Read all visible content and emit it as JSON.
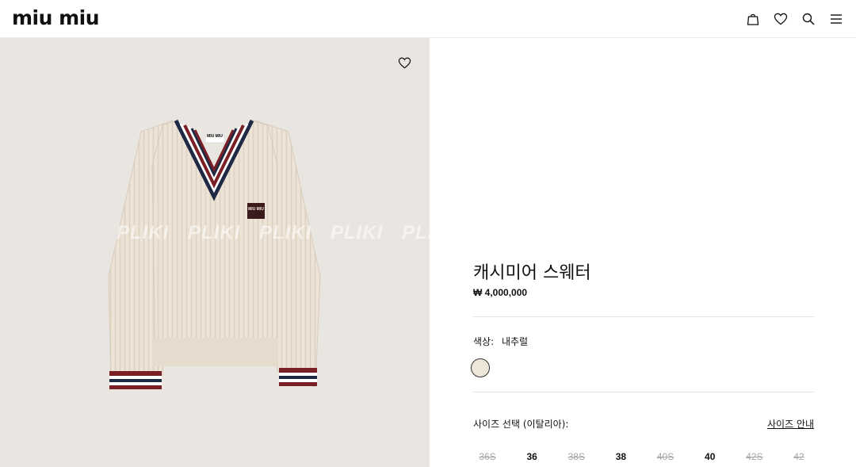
{
  "header": {
    "logo": "miu miu",
    "icons": [
      "bag-icon",
      "heart-icon",
      "search-icon",
      "menu-icon"
    ]
  },
  "watermark": [
    "PLIKI",
    "PLIKI",
    "PLIKI",
    "PLIKI",
    "PLI"
  ],
  "product_image": {
    "label_text": "MIU MIU",
    "badge_text": "MIU MIU"
  },
  "product": {
    "title": "캐시미어 스웨터",
    "price": "₩ 4,000,000",
    "color_label": "색상:",
    "color_value": "내추럴",
    "size_label": "사이즈 선택 (이탈리아):",
    "size_guide": "사이즈 안내",
    "sizes": [
      {
        "label": "36S",
        "available": false
      },
      {
        "label": "36",
        "available": true
      },
      {
        "label": "38S",
        "available": false
      },
      {
        "label": "38",
        "available": true
      },
      {
        "label": "40S",
        "available": false
      },
      {
        "label": "40",
        "available": true
      },
      {
        "label": "42S",
        "available": false
      },
      {
        "label": "42",
        "available": false
      }
    ]
  },
  "colors": {
    "swatch": "#efe6da",
    "background": "#e9e6e1",
    "sweater": "#ede3d6",
    "stripe_red": "#7a1f25",
    "stripe_navy": "#1e2a44"
  }
}
